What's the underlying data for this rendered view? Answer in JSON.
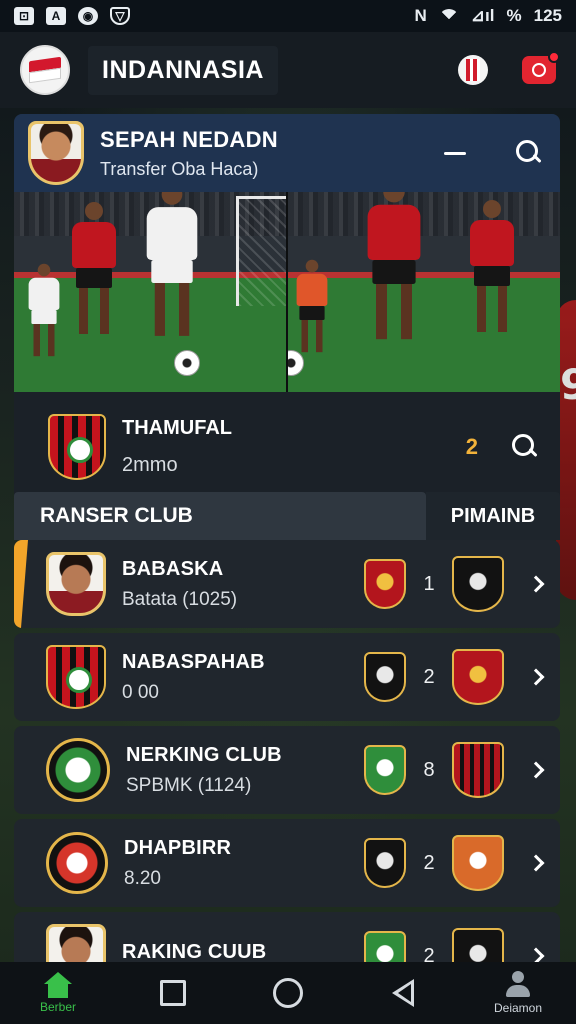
{
  "status_bar": {
    "left_icons": [
      "photo-icon",
      "a-icon",
      "o-icon",
      "shield-icon"
    ],
    "left_glyphs": [
      "⊡",
      "A",
      "◉",
      "▽"
    ],
    "nfc_glyph": "N",
    "signal_text": "⊿ıl",
    "battery_text": "%",
    "time": "125"
  },
  "header": {
    "title": "INDANNASIA"
  },
  "feature": {
    "title": "SEPAH NEDADN",
    "subtitle": "Transfer Oba Haca)"
  },
  "club_card": {
    "title": "THAMUFAL",
    "subtitle": "2mmo",
    "count": "2"
  },
  "tabs": {
    "left": "RANSER CLUB",
    "right": "PIMAINB"
  },
  "list": [
    {
      "title": "BABASKA",
      "subtitle": "Batata (1025)",
      "number": "1",
      "image": "player-photo",
      "mid_crest": "mc-red",
      "right_crest": "mc-dark",
      "active": true
    },
    {
      "title": "NABASPAHAB",
      "subtitle": "0 00",
      "number": "2",
      "image": "striped-crest",
      "mid_crest": "mc-dark",
      "right_crest": "mc-red"
    },
    {
      "title": "NERKING CLUB",
      "subtitle": "SPBMK (1124)",
      "number": "8",
      "image": "round-green-crest",
      "mid_crest": "mc-green",
      "right_crest": "mc-stripes"
    },
    {
      "title": "DHAPBIRR",
      "subtitle": "8.20",
      "number": "2",
      "image": "round-red-crest",
      "mid_crest": "mc-dark",
      "right_crest": "mc-orange"
    },
    {
      "title": "RAKING CUUB",
      "subtitle": "",
      "number": "2",
      "image": "player-photo",
      "mid_crest": "mc-green",
      "right_crest": "mc-dark"
    }
  ],
  "nav": {
    "home_label": "Berber",
    "profile_label": "Deiamon"
  },
  "colors": {
    "accent_green": "#39c04a",
    "accent_gold": "#f2b23a",
    "header_blue": "#1f3350",
    "brand_red": "#e22530"
  }
}
